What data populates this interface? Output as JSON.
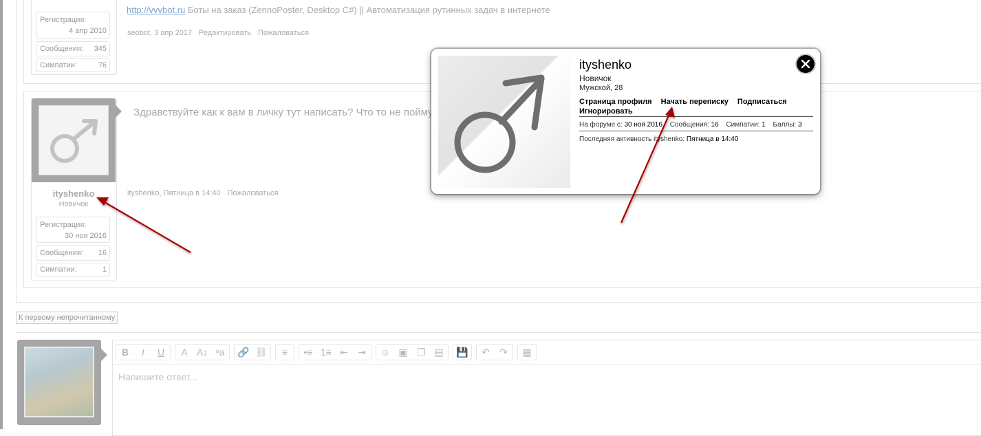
{
  "prev_post": {
    "stats": [
      {
        "label": "Регистрация:",
        "value": "4 апр 2010"
      },
      {
        "label": "Сообщения:",
        "value": "345"
      },
      {
        "label": "Симпатии:",
        "value": "76"
      }
    ],
    "signature_link": "http://vvvbot.ru",
    "signature_text": "Боты на заказ (ZennoPoster, Desktop C#) || Автоматизация рутинных задач в интернете",
    "meta_author_date": "seobot, 3 апр 2017",
    "meta_edit": "Редактировать",
    "meta_report": "Пожаловаться"
  },
  "post": {
    "username": "ityshenko",
    "user_title": "Новичок",
    "stats": [
      {
        "label": "Регистрация:",
        "value": "30 ноя 2016"
      },
      {
        "label": "Сообщения:",
        "value": "16"
      },
      {
        "label": "Симпатии:",
        "value": "1"
      }
    ],
    "message": "Здравствуйте как к вам в личку тут написать? Что то не пойму",
    "meta_author_date": "ityshenko, Пятница в 14:40",
    "meta_report": "Пожаловаться"
  },
  "unread_button": "К первому непрочитанному",
  "editor": {
    "placeholder": "Напишите ответ...",
    "toolbar_groups": [
      [
        "B",
        "I",
        "U"
      ],
      [
        "A",
        "A↕",
        "ᵃa"
      ],
      [
        "🔗",
        "⛓"
      ],
      [
        "≡"
      ],
      [
        "•≡",
        "1≡",
        "⇤",
        "⇥"
      ],
      [
        "☺",
        "▣",
        "❐",
        "▤"
      ],
      [
        "💾"
      ],
      [
        "↶",
        "↷"
      ],
      [
        "▦"
      ]
    ]
  },
  "popup": {
    "username": "ityshenko",
    "user_title": "Новичок",
    "info": "Мужской, 28",
    "links": [
      "Страница профиля",
      "Начать переписку",
      "Подписаться",
      "Игнорировать"
    ],
    "stats": [
      {
        "label": "На форуме с:",
        "value": "30 ноя 2016"
      },
      {
        "label": "Сообщения:",
        "value": "16"
      },
      {
        "label": "Симпатии:",
        "value": "1"
      },
      {
        "label": "Баллы:",
        "value": "3"
      }
    ],
    "last_activity_label": "Последняя активность ityshenko:",
    "last_activity_value": "Пятница в 14:40"
  },
  "colors": {
    "annotation_arrow": "#aa0000",
    "avatar_frame": "#a6a6a6",
    "link": "#7aa5cf"
  }
}
